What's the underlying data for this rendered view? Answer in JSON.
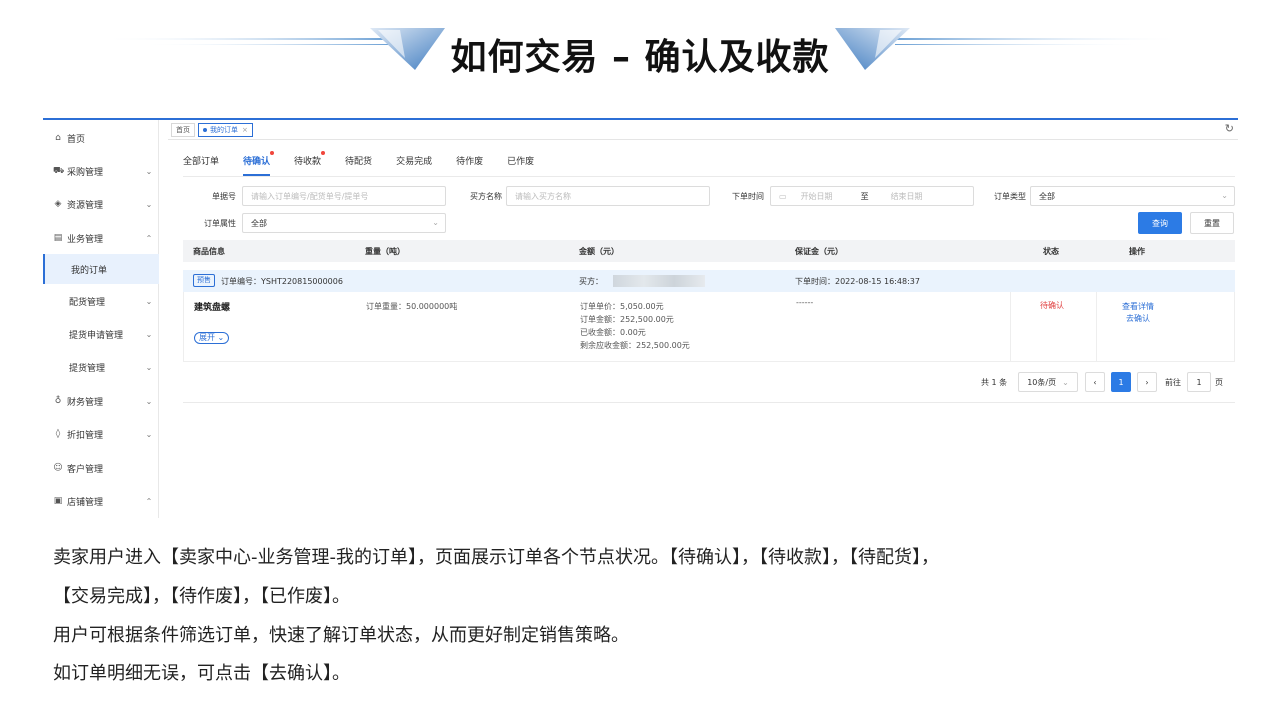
{
  "slide": {
    "title": "如何交易 – 确认及收款"
  },
  "sidebar": {
    "items": [
      {
        "label": "首页",
        "icon": "home-icon",
        "glyph": "⌂",
        "chevron": ""
      },
      {
        "label": "采购管理",
        "icon": "truck-icon",
        "glyph": "⛟",
        "chevron": "⌄"
      },
      {
        "label": "资源管理",
        "icon": "cube-icon",
        "glyph": "◈",
        "chevron": "⌄"
      },
      {
        "label": "业务管理",
        "icon": "clipboard-icon",
        "glyph": "▤",
        "chevron": "⌃"
      },
      {
        "label": "我的订单",
        "icon": "",
        "glyph": "",
        "chevron": ""
      },
      {
        "label": "配货管理",
        "icon": "",
        "glyph": "",
        "chevron": "⌄"
      },
      {
        "label": "提货申请管理",
        "icon": "",
        "glyph": "",
        "chevron": "⌄"
      },
      {
        "label": "提货管理",
        "icon": "",
        "glyph": "",
        "chevron": "⌄"
      },
      {
        "label": "财务管理",
        "icon": "finance-icon",
        "glyph": "♁",
        "chevron": "⌄"
      },
      {
        "label": "折扣管理",
        "icon": "tag-icon",
        "glyph": "◊",
        "chevron": "⌄"
      },
      {
        "label": "客户管理",
        "icon": "users-icon",
        "glyph": "☺",
        "chevron": ""
      },
      {
        "label": "店铺管理",
        "icon": "store-icon",
        "glyph": "▣",
        "chevron": "⌃"
      }
    ]
  },
  "page_tabs": {
    "home": "首页",
    "current": "我的订单",
    "close": "×",
    "refresh": "↻"
  },
  "status_tabs": [
    "全部订单",
    "待确认",
    "待收款",
    "待配货",
    "交易完成",
    "待作废",
    "已作废"
  ],
  "filters": {
    "order_no_label": "单据号",
    "order_no_placeholder": "请输入订单编号/配货单号/提单号",
    "buyer_label": "买方名称",
    "buyer_placeholder": "请输入买方名称",
    "time_label": "下单时间",
    "start_placeholder": "开始日期",
    "to": "至",
    "end_placeholder": "结束日期",
    "type_label": "订单类型",
    "type_value": "全部",
    "attr_label": "订单属性",
    "attr_value": "全部",
    "query_btn": "查询",
    "reset_btn": "重置"
  },
  "table": {
    "headers": [
      "商品信息",
      "重量（吨）",
      "金额（元）",
      "保证金（元）",
      "状态",
      "操作"
    ],
    "order": {
      "tag": "预售",
      "order_no": "订单编号：YSHT220815000006",
      "buyer_label": "买方：",
      "order_time": "下单时间：2022-08-15 16:48:37",
      "product": "建筑盘螺",
      "expand": "展开 ⌄",
      "weight": "订单重量：50.000000吨",
      "unit_price": "订单单价：5,050.00元",
      "amount": "订单金额：252,500.00元",
      "received": "已收金额：0.00元",
      "remaining": "剩余应收金额：252,500.00元",
      "deposit": "------",
      "status": "待确认",
      "op_detail": "查看详情",
      "op_confirm": "去确认"
    }
  },
  "pagination": {
    "total": "共 1 条",
    "page_size": "10条/页",
    "prev": "‹",
    "current": "1",
    "next": "›",
    "goto_label": "前往",
    "goto_value": "1",
    "page_unit": "页"
  },
  "description": {
    "line1": "卖家用户进入【卖家中心-业务管理-我的订单】，页面展示订单各个节点状况。【待确认】，【待收款】，【待配货】，",
    "line2": "【交易完成】，【待作废】，【已作废】。",
    "line3": "用户可根据条件筛选订单，快速了解订单状态，从而更好制定销售策略。",
    "line4": "如订单明细无误，可点击【去确认】。"
  },
  "colors": {
    "accent": "#2c7be5",
    "status_red": "#e04040",
    "row_highlight": "#eaf3fd"
  }
}
